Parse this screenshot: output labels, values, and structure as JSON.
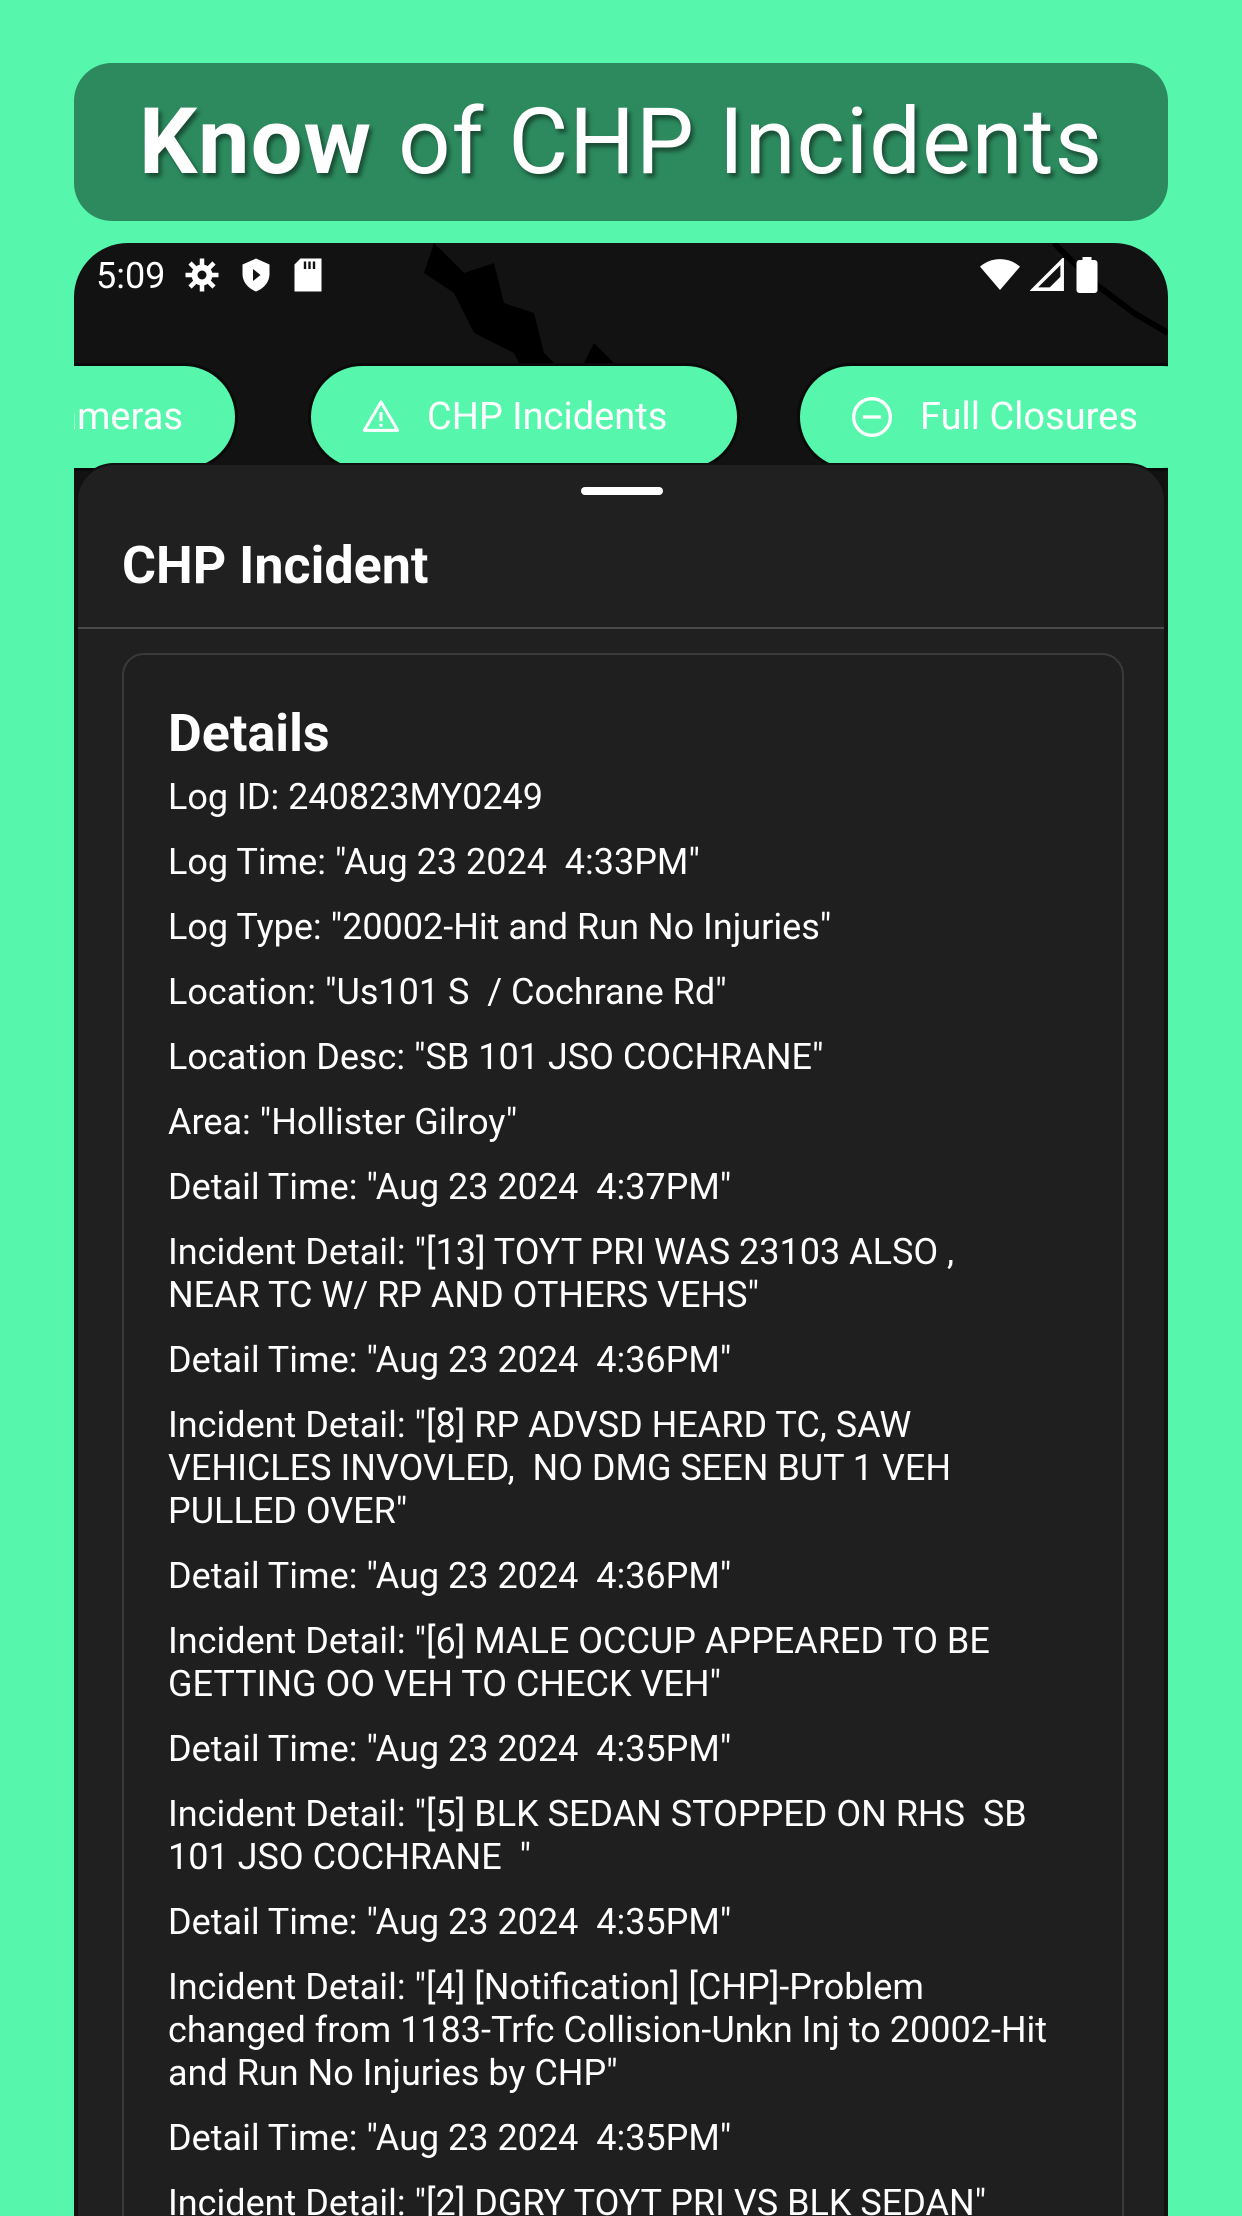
{
  "banner": {
    "strong": "Know",
    "rest": "of CHP Incidents"
  },
  "status_bar": {
    "time": "5:09"
  },
  "chips": [
    {
      "label": "ameras",
      "icon": ""
    },
    {
      "label": "CHP Incidents",
      "icon": "warning-icon"
    },
    {
      "label": "Full Closures",
      "icon": "closure-icon"
    }
  ],
  "sheet": {
    "title": "CHP Incident"
  },
  "details": {
    "heading": "Details",
    "lines": [
      "Log ID: 240823MY0249",
      "Log Time: \"Aug 23 2024  4:33PM\"",
      "Log Type: \"20002-Hit and Run No Injuries\"",
      "Location: \"Us101 S  / Cochrane Rd\"",
      "Location Desc: \"SB 101 JSO COCHRANE\"",
      "Area: \"Hollister Gilroy\"",
      "Detail Time: \"Aug 23 2024  4:37PM\"",
      "Incident Detail: \"[13] TOYT PRI WAS 23103 ALSO ,\nNEAR TC W/ RP AND OTHERS VEHS\"",
      "Detail Time: \"Aug 23 2024  4:36PM\"",
      "Incident Detail: \"[8] RP ADVSD HEARD TC, SAW\nVEHICLES INVOVLED,  NO DMG SEEN BUT 1 VEH\nPULLED OVER\"",
      "Detail Time: \"Aug 23 2024  4:36PM\"",
      "Incident Detail: \"[6] MALE OCCUP APPEARED TO BE\nGETTING OO VEH TO CHECK VEH\"",
      "Detail Time: \"Aug 23 2024  4:35PM\"",
      "Incident Detail: \"[5] BLK SEDAN STOPPED ON RHS  SB\n101 JSO COCHRANE  \"",
      "Detail Time: \"Aug 23 2024  4:35PM\"",
      "Incident Detail: \"[4] [Notification] [CHP]-Problem\nchanged from 1183-Trfc Collision-Unkn Inj to 20002-Hit\nand Run No Injuries by CHP\"",
      "Detail Time: \"Aug 23 2024  4:35PM\"",
      "Incident Detail: \"[2] DGRY TOYT PRI VS BLK SEDAN\""
    ]
  }
}
